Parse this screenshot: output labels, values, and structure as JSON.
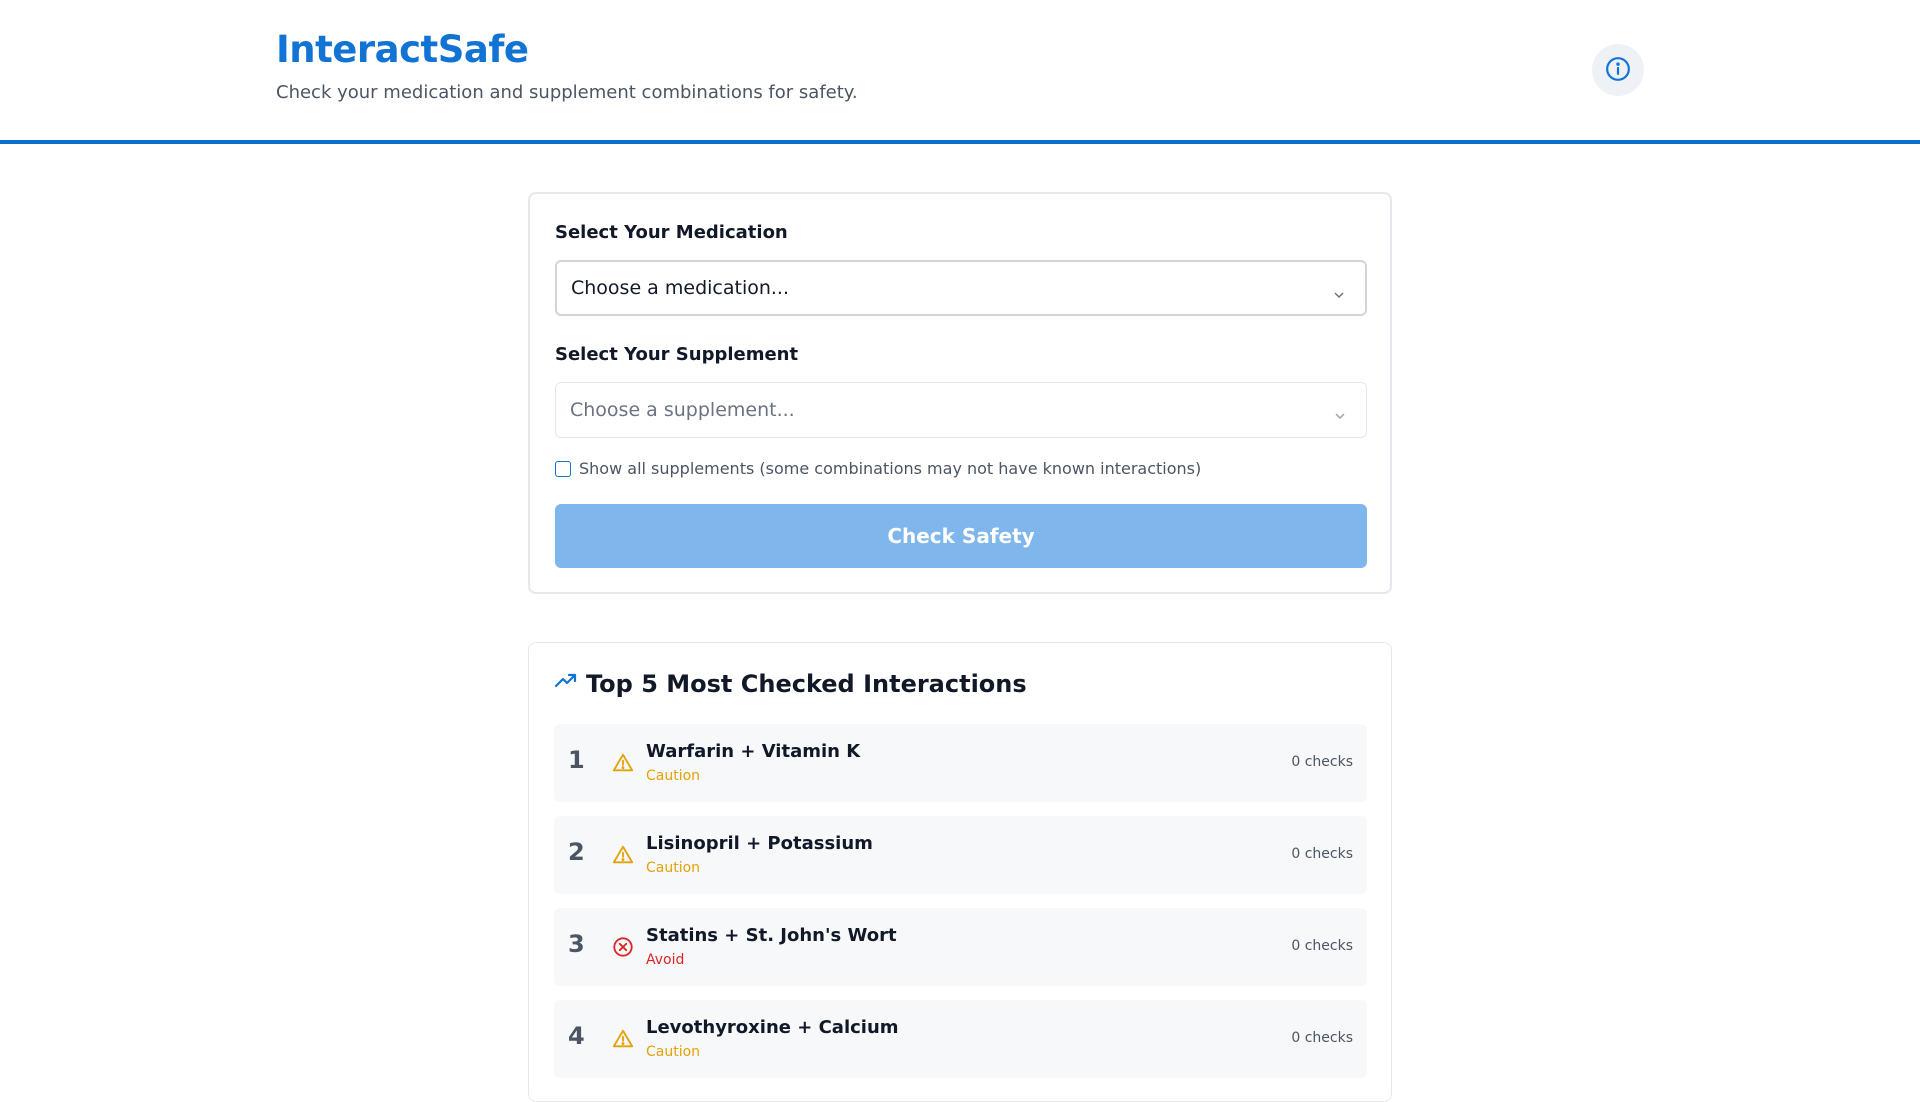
{
  "header": {
    "brand": "InteractSafe",
    "tagline": "Check your medication and supplement combinations for safety."
  },
  "form": {
    "medication_label": "Select Your Medication",
    "medication_value": "Choose a medication...",
    "supplement_label": "Select Your Supplement",
    "supplement_value": "Choose a supplement...",
    "show_all_label": "Show all supplements (some combinations may not have known interactions)",
    "check_button": "Check Safety"
  },
  "top": {
    "title": "Top 5 Most Checked Interactions",
    "items": [
      {
        "rank": "1",
        "title": "Warfarin + Vitamin K",
        "status": "Caution",
        "count": "0 checks",
        "icon": "warning-icon"
      },
      {
        "rank": "2",
        "title": "Lisinopril + Potassium",
        "status": "Caution",
        "count": "0 checks",
        "icon": "warning-icon"
      },
      {
        "rank": "3",
        "title": "Statins + St. John's Wort",
        "status": "Avoid",
        "count": "0 checks",
        "icon": "x-circle-icon"
      },
      {
        "rank": "4",
        "title": "Levothyroxine + Calcium",
        "status": "Caution",
        "count": "0 checks",
        "icon": "warning-icon"
      }
    ]
  },
  "colors": {
    "brand": "#1173d4",
    "caution": "#e5a106",
    "avoid": "#dc2626",
    "button_disabled": "#7fb6ec"
  }
}
